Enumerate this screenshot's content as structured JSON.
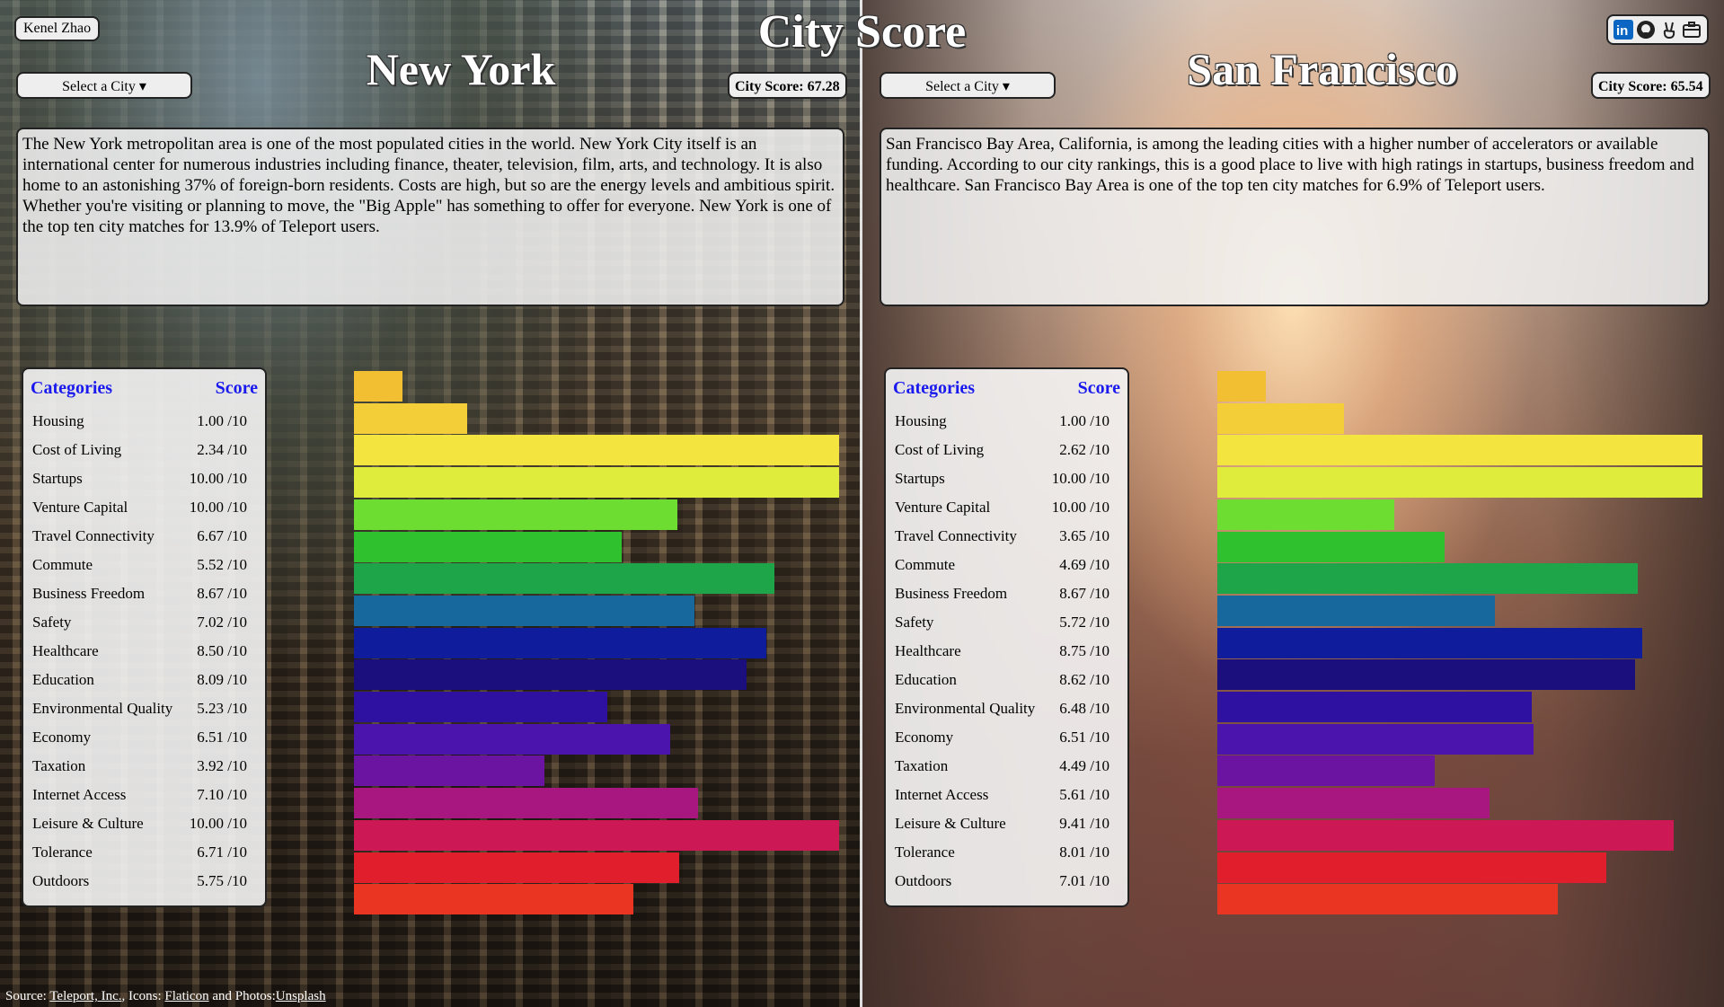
{
  "header": {
    "title": "City Score",
    "user": "Kenel Zhao",
    "social": [
      "linkedin-icon",
      "github-icon",
      "angellist-icon",
      "portfolio-icon"
    ]
  },
  "left": {
    "select_label": "Select a City ▾",
    "city": "New York",
    "score_text": "City Score: 67.28",
    "description": "The New York metropolitan area is one of the most populated cities in the world. New York City itself is an international center for numerous industries including finance, theater, television, film, arts, and technology. It is also home to an astonishing 37% of foreign-born residents. Costs are high, but so are the energy levels and ambitious spirit. Whether you're visiting or planning to move, the \"Big Apple\" has something to offer for everyone. New York is one of the top ten city matches for 13.9% of Teleport users.",
    "col_categories": "Categories",
    "col_score": "Score",
    "rows": [
      {
        "cat": "Housing",
        "score": "1.00 /10"
      },
      {
        "cat": "Cost of Living",
        "score": "2.34 /10"
      },
      {
        "cat": "Startups",
        "score": "10.00 /10"
      },
      {
        "cat": "Venture Capital",
        "score": "10.00 /10"
      },
      {
        "cat": "Travel Connectivity",
        "score": "6.67 /10"
      },
      {
        "cat": "Commute",
        "score": "5.52 /10"
      },
      {
        "cat": "Business Freedom",
        "score": "8.67 /10"
      },
      {
        "cat": "Safety",
        "score": "7.02 /10"
      },
      {
        "cat": "Healthcare",
        "score": "8.50 /10"
      },
      {
        "cat": "Education",
        "score": "8.09 /10"
      },
      {
        "cat": "Environmental Quality",
        "score": "5.23 /10"
      },
      {
        "cat": "Economy",
        "score": "6.51 /10"
      },
      {
        "cat": "Taxation",
        "score": "3.92 /10"
      },
      {
        "cat": "Internet Access",
        "score": "7.10 /10"
      },
      {
        "cat": "Leisure & Culture",
        "score": "10.00 /10"
      },
      {
        "cat": "Tolerance",
        "score": "6.71 /10"
      },
      {
        "cat": "Outdoors",
        "score": "5.75 /10"
      }
    ],
    "values": [
      1.0,
      2.34,
      10.0,
      10.0,
      6.67,
      5.52,
      8.67,
      7.02,
      8.5,
      8.09,
      5.23,
      6.51,
      3.92,
      7.1,
      10.0,
      6.71,
      5.75
    ]
  },
  "right": {
    "select_label": "Select a City ▾",
    "city": "San Francisco",
    "score_text": "City Score: 65.54",
    "description": "San Francisco Bay Area, California, is among the leading cities with a higher number of accelerators or available funding. According to our city rankings, this is a good place to live with high ratings in startups, business freedom and healthcare. San Francisco Bay Area is one of the top ten city matches for 6.9% of Teleport users.",
    "col_categories": "Categories",
    "col_score": "Score",
    "rows": [
      {
        "cat": "Housing",
        "score": "1.00 /10"
      },
      {
        "cat": "Cost of Living",
        "score": "2.62 /10"
      },
      {
        "cat": "Startups",
        "score": "10.00 /10"
      },
      {
        "cat": "Venture Capital",
        "score": "10.00 /10"
      },
      {
        "cat": "Travel Connectivity",
        "score": "3.65 /10"
      },
      {
        "cat": "Commute",
        "score": "4.69 /10"
      },
      {
        "cat": "Business Freedom",
        "score": "8.67 /10"
      },
      {
        "cat": "Safety",
        "score": "5.72 /10"
      },
      {
        "cat": "Healthcare",
        "score": "8.75 /10"
      },
      {
        "cat": "Education",
        "score": "8.62 /10"
      },
      {
        "cat": "Environmental Quality",
        "score": "6.48 /10"
      },
      {
        "cat": "Economy",
        "score": "6.51 /10"
      },
      {
        "cat": "Taxation",
        "score": "4.49 /10"
      },
      {
        "cat": "Internet Access",
        "score": "5.61 /10"
      },
      {
        "cat": "Leisure & Culture",
        "score": "9.41 /10"
      },
      {
        "cat": "Tolerance",
        "score": "8.01 /10"
      },
      {
        "cat": "Outdoors",
        "score": "7.01 /10"
      }
    ],
    "values": [
      1.0,
      2.62,
      10.0,
      10.0,
      3.65,
      4.69,
      8.67,
      5.72,
      8.75,
      8.62,
      6.48,
      6.51,
      4.49,
      5.61,
      9.41,
      8.01,
      7.01
    ]
  },
  "bar_colors": [
    "#f3bf32",
    "#f3ce38",
    "#f3e440",
    "#e0ec3b",
    "#6ddd31",
    "#2fc12e",
    "#1ea54a",
    "#17699d",
    "#0f1c9b",
    "#1a0f7c",
    "#2f11a2",
    "#4b14ac",
    "#6c14a2",
    "#a8167f",
    "#cd1856",
    "#e01e2c",
    "#ea3523"
  ],
  "footer": {
    "prefix": "Source: ",
    "teleport": "Teleport, Inc.",
    "icons_prefix": ", Icons: ",
    "flaticon": "Flaticon",
    "photos_prefix": " and Photos:",
    "unsplash": "Unsplash"
  }
}
